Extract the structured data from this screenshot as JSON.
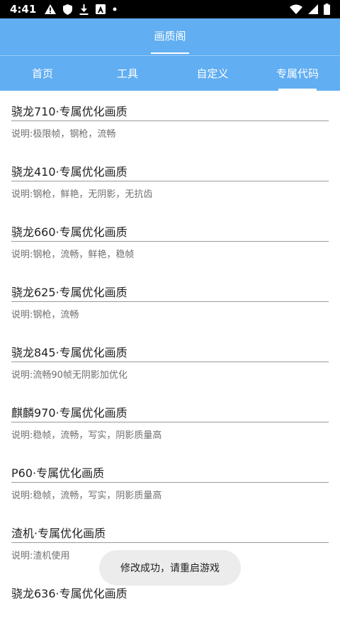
{
  "status_bar": {
    "time": "4:41",
    "icons_left": [
      "alert-icon",
      "shield-icon",
      "download-icon",
      "text-a-icon",
      "dot-icon"
    ],
    "icons_right": [
      "wifi-icon",
      "signal-icon",
      "battery-icon"
    ]
  },
  "app": {
    "title": "画质阁",
    "accent_color": "#61aef2"
  },
  "tabs": [
    {
      "label": "首页",
      "active": false
    },
    {
      "label": "工具",
      "active": false
    },
    {
      "label": "自定义",
      "active": false
    },
    {
      "label": "专属代码",
      "active": true
    }
  ],
  "items": [
    {
      "title": "骁龙710·专属优化画质",
      "desc": "说明:极限帧，钢枪，流畅"
    },
    {
      "title": "骁龙410·专属优化画质",
      "desc": "说明:钢枪，鲜艳，无阴影，无抗齿"
    },
    {
      "title": "骁龙660·专属优化画质",
      "desc": "说明:钢枪，流畅，鲜艳，稳帧"
    },
    {
      "title": "骁龙625·专属优化画质",
      "desc": "说明:钢枪，流畅"
    },
    {
      "title": "骁龙845·专属优化画质",
      "desc": "说明:流畅90帧无阴影加优化"
    },
    {
      "title": "麒麟970·专属优化画质",
      "desc": "说明:稳帧，流畅，写实，阴影质量高"
    },
    {
      "title": "P60·专属优化画质",
      "desc": "说明:稳帧，流畅，写实，阴影质量高"
    },
    {
      "title": "渣机·专属优化画质",
      "desc": "说明:渣机使用"
    },
    {
      "title": "骁龙636·专属优化画质",
      "desc": ""
    }
  ],
  "toast": {
    "message": "修改成功，请重启游戏"
  }
}
